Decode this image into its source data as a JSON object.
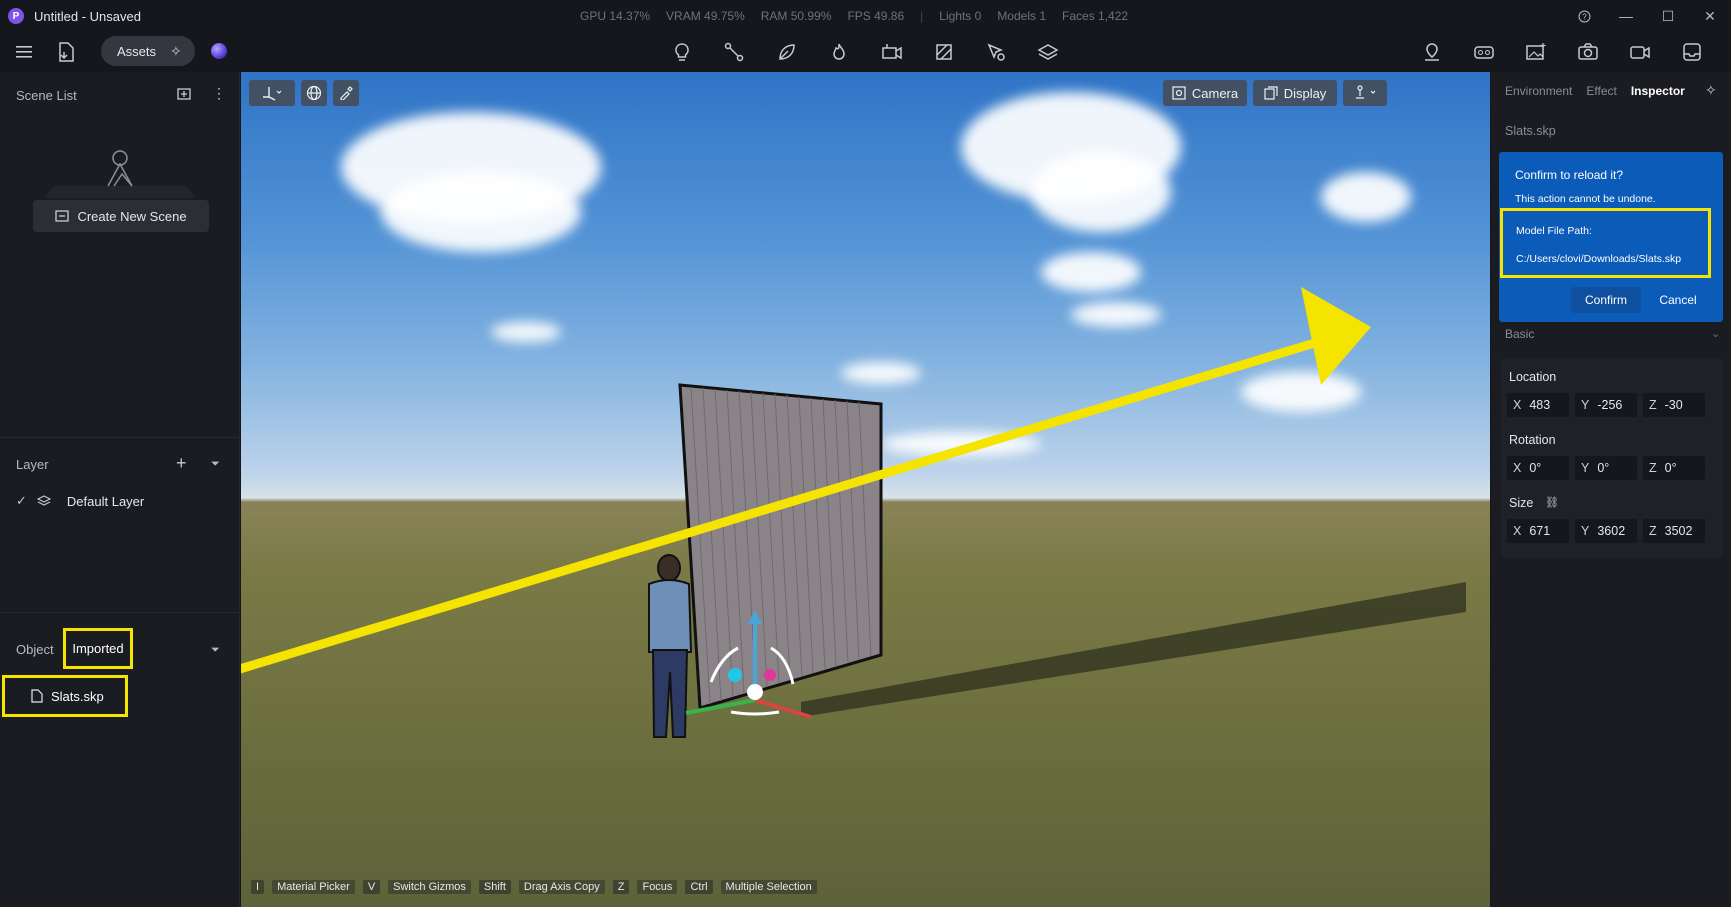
{
  "window": {
    "title": "Untitled - Unsaved",
    "logo_letter": "P"
  },
  "stats": [
    "GPU 14.37%",
    "VRAM 49.75%",
    "RAM 50.99%",
    "FPS 49.86",
    "Lights 0",
    "Models 1",
    "Faces 1,422"
  ],
  "toolbar": {
    "assets_label": "Assets"
  },
  "scene_list": {
    "title": "Scene List",
    "create_label": "Create New Scene"
  },
  "layer": {
    "title": "Layer",
    "default_layer": "Default Layer"
  },
  "object": {
    "title": "Object",
    "tab_label": "Imported",
    "file": "Slats.skp"
  },
  "viewport": {
    "camera_label": "Camera",
    "display_label": "Display",
    "shortcuts": [
      {
        "key": "I",
        "label": "Material Picker"
      },
      {
        "key": "V",
        "label": "Switch Gizmos"
      },
      {
        "key": "Shift",
        "label": "Drag Axis Copy"
      },
      {
        "key": "Z",
        "label": "Focus"
      },
      {
        "key": "Ctrl",
        "label": "Multiple Selection"
      }
    ]
  },
  "inspector": {
    "tabs": [
      "Environment",
      "Effect",
      "Inspector"
    ],
    "active_tab": "Inspector",
    "file_name": "Slats.skp",
    "dialog": {
      "heading": "Confirm to reload it?",
      "subtext": "This action cannot be undone.",
      "path_label": "Model File Path:",
      "path": "C:/Users/clovi/Downloads/Slats.skp",
      "confirm": "Confirm",
      "cancel": "Cancel"
    },
    "basic_label": "Basic",
    "location": {
      "label": "Location",
      "x": "483",
      "y": "-256",
      "z": "-30"
    },
    "rotation": {
      "label": "Rotation",
      "x": "0°",
      "y": "0°",
      "z": "0°"
    },
    "size": {
      "label": "Size",
      "x": "671",
      "y": "3602",
      "z": "3502"
    }
  },
  "colors": {
    "highlight": "#f5e400",
    "dialog_bg": "#0b5bb8",
    "panel_bg": "#1a1c22"
  }
}
